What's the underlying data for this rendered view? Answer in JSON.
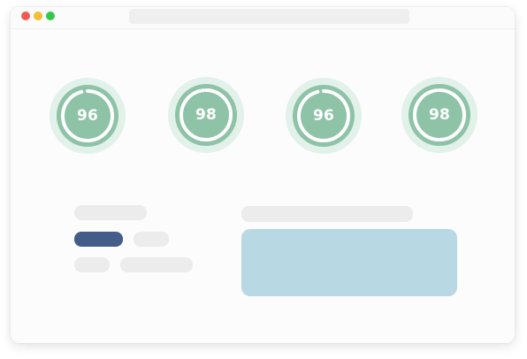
{
  "window": {
    "title": "",
    "address_bar": ""
  },
  "scores": [
    {
      "name": "score-1",
      "value": "96",
      "percent": 96
    },
    {
      "name": "score-2",
      "value": "98",
      "percent": 98
    },
    {
      "name": "score-3",
      "value": "96",
      "percent": 96
    },
    {
      "name": "score-4",
      "value": "98",
      "percent": 98
    }
  ],
  "colors": {
    "score_fill": "#8ec3a7",
    "score_halo": "#d9eee3",
    "score_ring": "#ffffff",
    "accent_skeleton": "#435c89",
    "preview_card": "#b8d8e3"
  }
}
